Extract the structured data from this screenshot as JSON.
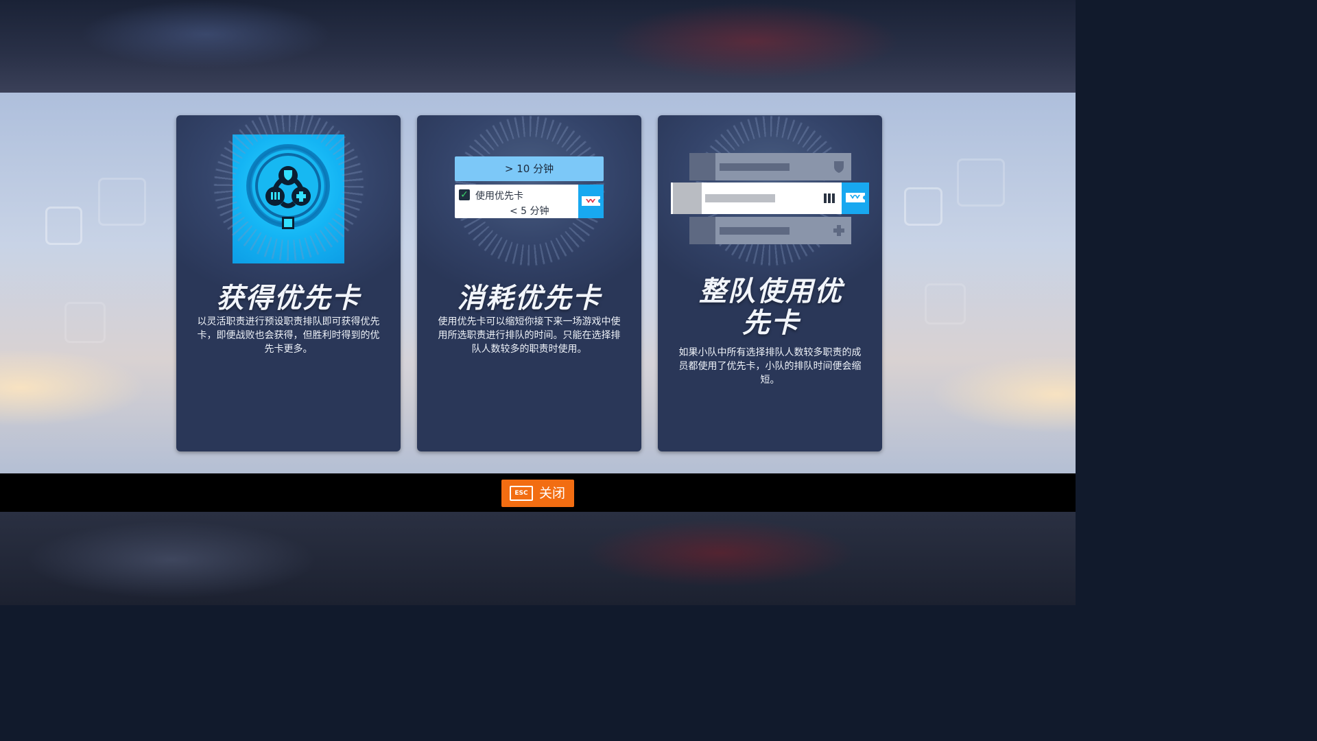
{
  "cards": [
    {
      "title": "获得优先卡",
      "description": "以灵活职责进行预设职责排队即可获得优先卡，即便战败也会获得，但胜利时得到的优先卡更多。"
    },
    {
      "title": "消耗优先卡",
      "description": "使用优先卡可以缩短你接下来一场游戏中使用所选职责进行排队的时间。只能在选择排队人数较多的职责时使用。",
      "queue_time_label": "> 10 分钟",
      "priority_checkbox_label": "使用优先卡",
      "priority_time_label": "< 5 分钟"
    },
    {
      "title": "整队使用优先卡",
      "description": "如果小队中所有选择排队人数较多职责的成员都使用了优先卡，小队的排队时间便会缩短。"
    }
  ],
  "footer": {
    "esc_key": "ESC",
    "close_label": "关闭"
  },
  "colors": {
    "accent_blue": "#18a8f0",
    "close_orange": "#f26d12",
    "panel_bg": "#34446a"
  },
  "icons": {
    "role_tank": "shield-icon",
    "role_damage": "bullets-icon",
    "role_support": "plus-icon",
    "ticket": "priority-ticket-icon"
  }
}
